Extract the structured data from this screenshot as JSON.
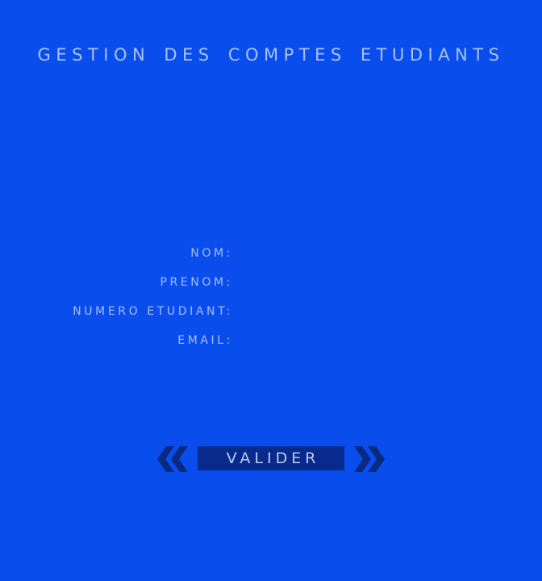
{
  "header": {
    "title": "GESTION DES COMPTES ETUDIANTS"
  },
  "form": {
    "fields": [
      {
        "label": "NOM:",
        "value": ""
      },
      {
        "label": "PRENOM:",
        "value": ""
      },
      {
        "label": "NUMERO ETUDIANT:",
        "value": ""
      },
      {
        "label": "EMAIL:",
        "value": ""
      }
    ]
  },
  "actions": {
    "submit_label": "VALIDER",
    "left_decoration_icon": "double-chevron-left-icon",
    "right_decoration_icon": "double-chevron-right-icon"
  },
  "colors": {
    "background": "#0a4ded",
    "button": "#082a8c",
    "text": "#a9c2ee",
    "chevron": "#0a2a7e"
  }
}
